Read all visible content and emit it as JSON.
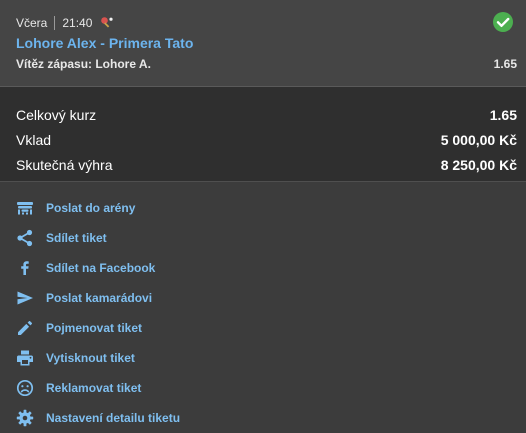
{
  "ticket": {
    "day": "Včera",
    "time": "21:40",
    "sport_icon": "table-tennis-icon",
    "status_icon": "check-circle-icon",
    "match": "Lohore Alex - Primera Tato",
    "market": "Vítěz zápasu: Lohore A.",
    "odds": "1.65"
  },
  "summary": {
    "total_odds_label": "Celkový kurz",
    "total_odds_value": "1.65",
    "stake_label": "Vklad",
    "stake_value": "5 000,00 Kč",
    "win_label": "Skutečná výhra",
    "win_value": "8 250,00 Kč"
  },
  "actions": [
    {
      "label": "Poslat do arény",
      "icon": "arena-icon"
    },
    {
      "label": "Sdílet tiket",
      "icon": "share-icon"
    },
    {
      "label": "Sdílet na Facebook",
      "icon": "facebook-icon"
    },
    {
      "label": "Poslat kamarádovi",
      "icon": "send-icon"
    },
    {
      "label": "Pojmenovat tiket",
      "icon": "pencil-icon"
    },
    {
      "label": "Vytisknout tiket",
      "icon": "print-icon"
    },
    {
      "label": "Reklamovat tiket",
      "icon": "sad-face-icon"
    },
    {
      "label": "Nastavení detailu tiketu",
      "icon": "gear-icon"
    }
  ],
  "colors": {
    "accent": "#6cb4ee",
    "success": "#4caf50",
    "icon": "#7fbff0"
  }
}
